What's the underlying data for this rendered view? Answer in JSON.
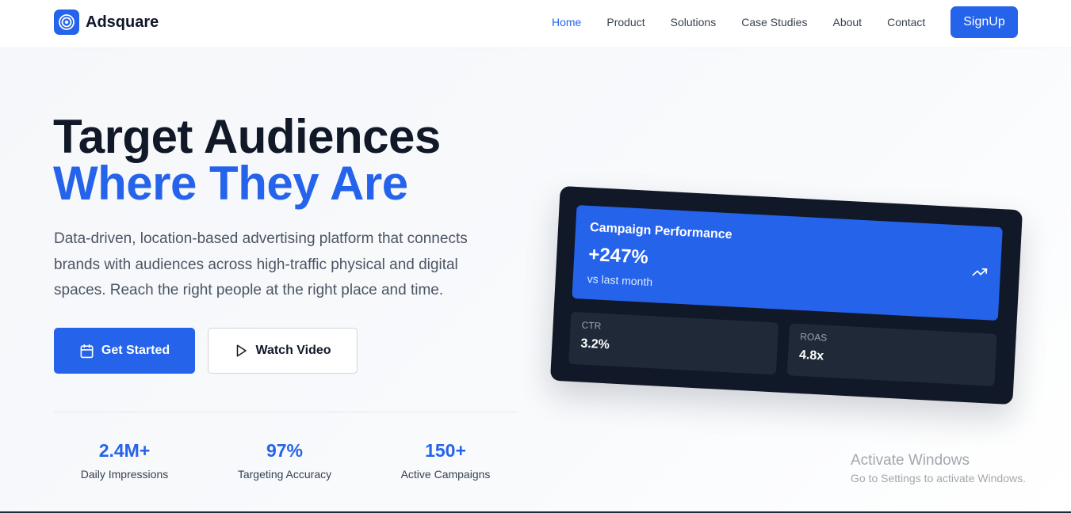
{
  "brand": {
    "name": "Adsquare",
    "accent": "#2563eb"
  },
  "nav": {
    "items": [
      {
        "label": "Home",
        "active": true
      },
      {
        "label": "Product",
        "active": false
      },
      {
        "label": "Solutions",
        "active": false
      },
      {
        "label": "Case Studies",
        "active": false
      },
      {
        "label": "About",
        "active": false
      },
      {
        "label": "Contact",
        "active": false
      }
    ],
    "signup_label": "SignUp"
  },
  "hero": {
    "title_line1": "Target Audiences",
    "title_line2": "Where They Are",
    "description": "Data-driven, location-based advertising platform that connects brands with audiences across high-traffic physical and digital spaces. Reach the right people at the right place and time.",
    "primary_button": {
      "label": "Get Started",
      "icon": "calendar-icon"
    },
    "secondary_button": {
      "label": "Watch Video",
      "icon": "play-icon"
    }
  },
  "stats": [
    {
      "value": "2.4M+",
      "label": "Daily Impressions"
    },
    {
      "value": "97%",
      "label": "Targeting Accuracy"
    },
    {
      "value": "150+",
      "label": "Active Campaigns"
    }
  ],
  "dashboard": {
    "panel_title": "Campaign Performance",
    "panel_value": "+247%",
    "panel_subtitle": "vs last month",
    "trend_icon": "trending-up-icon",
    "metrics": [
      {
        "label": "CTR",
        "value": "3.2%"
      },
      {
        "label": "ROAS",
        "value": "4.8x"
      }
    ]
  },
  "watermark": {
    "title": "Activate Windows",
    "subtitle": "Go to Settings to activate Windows."
  }
}
